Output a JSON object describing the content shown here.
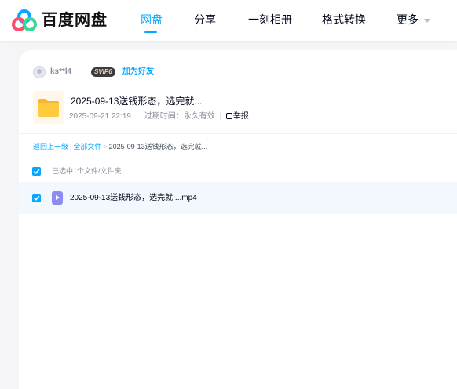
{
  "brand": {
    "name": "百度网盘"
  },
  "nav": {
    "items": [
      {
        "label": "网盘",
        "active": true
      },
      {
        "label": "分享",
        "active": false
      },
      {
        "label": "一刻相册",
        "active": false
      },
      {
        "label": "格式转换",
        "active": false
      },
      {
        "label": "更多",
        "active": false
      }
    ],
    "accent": "#06a7ff"
  },
  "sharer": {
    "username": "ks**l4",
    "vip_badge": "SVIP6",
    "add_friend_label": "加为好友"
  },
  "share": {
    "title": "2025-09-13送钱形态，选完就...",
    "date": "2025-09-21 22:19",
    "expire_label": "过期时间：永久有效",
    "report_label": "举报"
  },
  "breadcrumb": {
    "back_label": "返回上一级",
    "all_files_label": "全部文件",
    "separator": ">",
    "current": "2025-09-13送钱形态，选完就..."
  },
  "selection": {
    "summary": "已选中1个文件/文件夹"
  },
  "files": [
    {
      "name": "2025-09-13送钱形态，选完就....mp4",
      "icon": "video-file-icon",
      "checked": true
    }
  ]
}
